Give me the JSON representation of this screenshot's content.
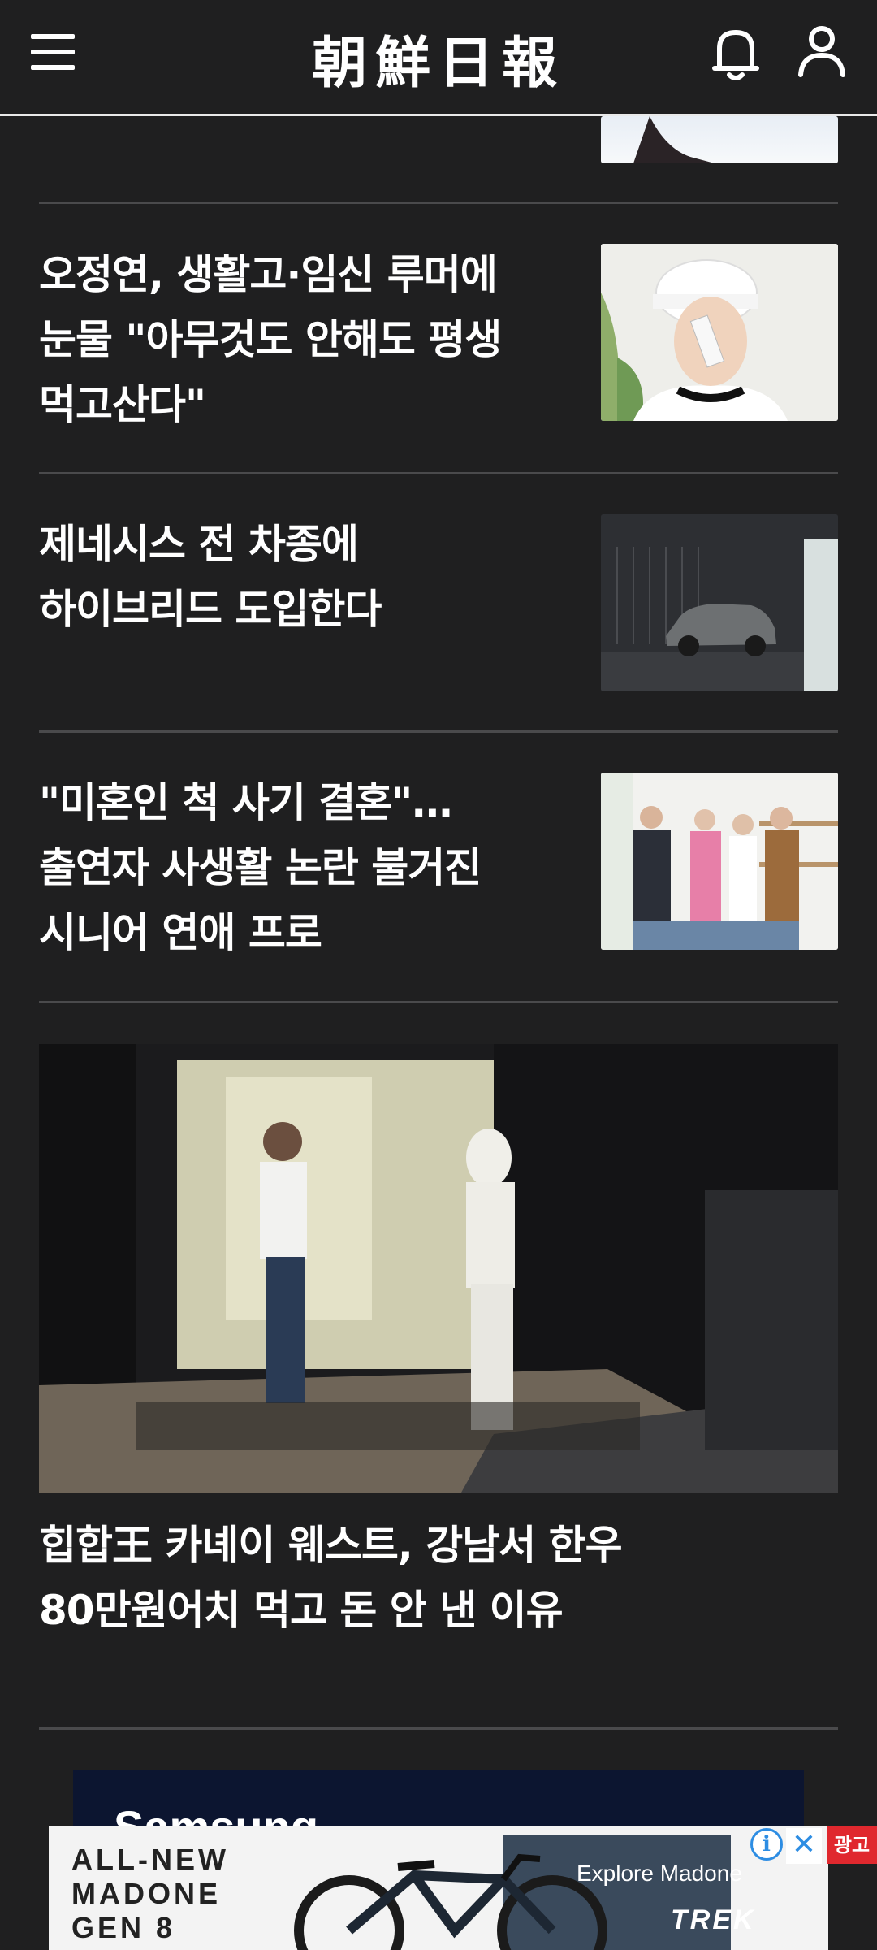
{
  "header": {
    "logo": "朝鮮日報",
    "menu_icon": "hamburger-menu-icon",
    "notification_icon": "bell-icon",
    "account_icon": "user-icon"
  },
  "articles": [
    {
      "headline": "오정연, 생활고·임신 루머에\n눈물 \"아무것도 안해도 평생\n먹고산다\""
    },
    {
      "headline": "제네시스 전 차종에\n하이브리드 도입한다"
    },
    {
      "headline": "\"미혼인 척 사기 결혼\"…\n출연자 사생활 논란 불거진\n시니어 연애 프로"
    }
  ],
  "featured": {
    "headline": "힙합王 카녜이 웨스트, 강남서 한우\n80만원어치 먹고 돈 안 낸 이유"
  },
  "ads": {
    "top_text": "Samsung",
    "model_text": "ALL-NEW\nMADONE\nGEN 8",
    "explore_text": "Explore Madone",
    "brand": "TREK",
    "info": "i",
    "close": "✕",
    "label": "광고"
  },
  "colors": {
    "background": "#1f1f20",
    "divider": "#4a4a4c",
    "ad_label": "#e0282e"
  }
}
